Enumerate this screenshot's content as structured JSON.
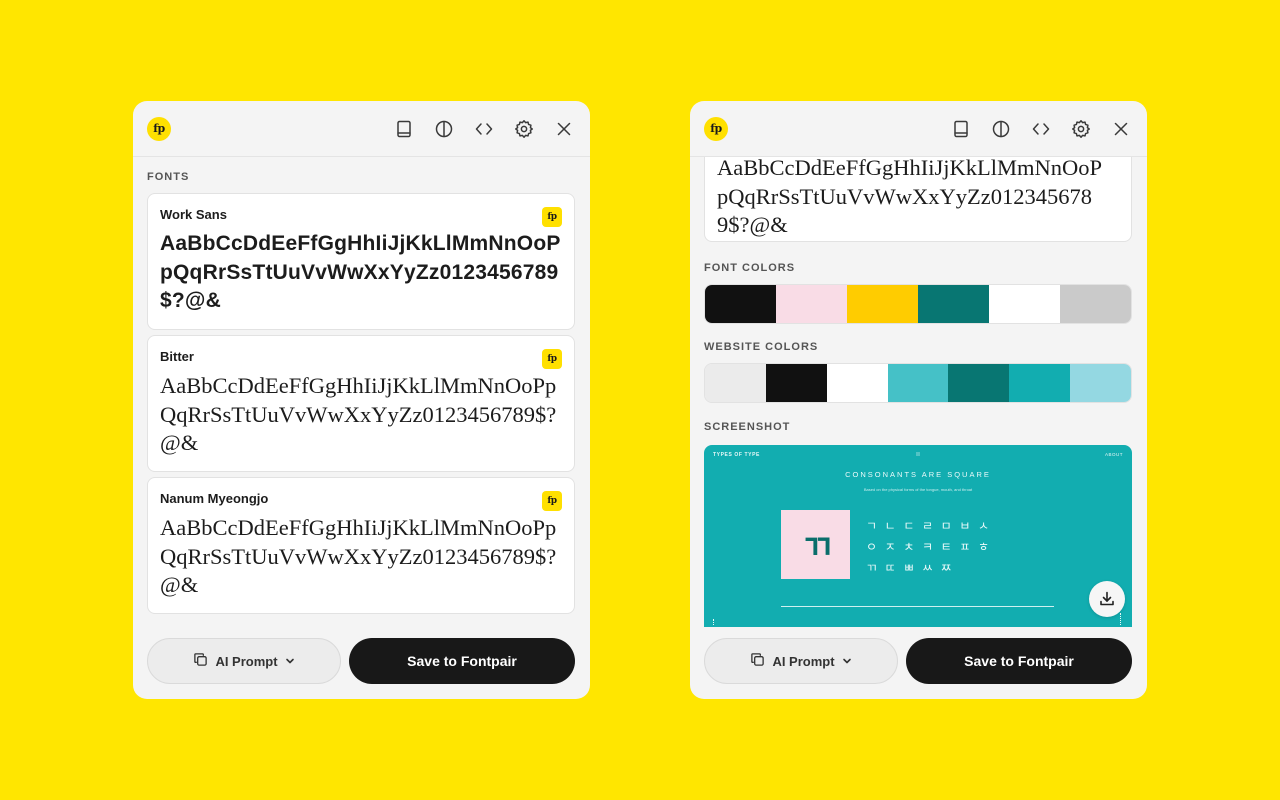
{
  "brand": {
    "logo_text": "fp"
  },
  "header": {
    "icons": [
      "book-icon",
      "contrast-icon",
      "code-icon",
      "settings-icon",
      "close-icon"
    ]
  },
  "left_panel": {
    "fonts_label": "FONTS",
    "fonts": [
      {
        "name": "Work Sans",
        "badge": "fp",
        "sample": "AaBbCcDdEeFfGgHhIiJjKkLlMmNnOoPpQqRrSsTtUuVvWwXxYyZz0123456789$?@&"
      },
      {
        "name": "Bitter",
        "badge": "fp",
        "sample": "AaBbCcDdEeFfGgHhIiJjKkLlMmNnOoPpQqRrSsTtUuVvWwXxYyZz0123456789$?@&"
      },
      {
        "name": "Nanum Myeongjo",
        "badge": "fp",
        "sample": "AaBbCcDdEeFfGgHhIiJjKkLlMmNnOoPpQqRrSsTtUuVvWwXxYyZz0123456789$?@&"
      }
    ]
  },
  "right_panel": {
    "top_sample_lines": [
      "AaBbCcDdEeFfGgHhIiJjKkLlMmNnOoP",
      "pQqRrSsTtUuVvWwXxYyZz012345678",
      "9$?@&"
    ],
    "font_colors_label": "FONT COLORS",
    "font_colors": [
      "#111111",
      "#F9DCE6",
      "#FFCC00",
      "#087672",
      "#FFFFFF",
      "#CACACA"
    ],
    "website_colors_label": "WEBSITE COLORS",
    "website_colors": [
      "#EBEBEB",
      "#111111",
      "#FFFFFF",
      "#45C1C7",
      "#087672",
      "#12ADB0",
      "#94D8E2"
    ],
    "screenshot_label": "SCREENSHOT",
    "screenshot": {
      "brand": "TYPES OF TYPE",
      "about": "ABOUT",
      "title": "CONSONANTS ARE SQUARE",
      "subtitle": "Based on the physical forms of the tongue, mouth, and throat",
      "tile_glyph": "ㄲ",
      "jamo_rows": [
        "ㄱ  ㄴ  ㄷ  ㄹ  ㅁ  ㅂ  ㅅ",
        "ㅇ  ㅈ  ㅊ  ㅋ  ㅌ  ㅍ  ㅎ",
        "ㄲ  ㄸ  ㅃ  ㅆ  ㅉ"
      ]
    }
  },
  "footer": {
    "ai_prompt_label": "AI Prompt",
    "save_label": "Save to Fontpair"
  }
}
